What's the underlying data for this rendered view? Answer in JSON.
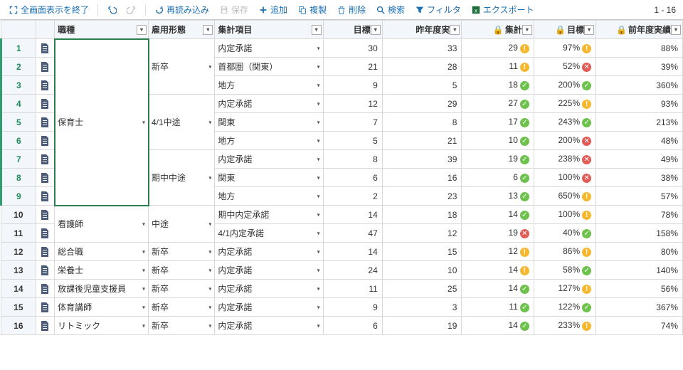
{
  "toolbar": {
    "exit_full": "全画面表示を終了",
    "reload": "再読み込み",
    "save": "保存",
    "add": "追加",
    "copy": "複製",
    "delete": "削除",
    "search": "検索",
    "filter": "フィルタ",
    "export": "エクスポート"
  },
  "status": {
    "range": "1 - 16"
  },
  "columns": {
    "c0": "職種",
    "c1": "雇用形態",
    "c2": "集計項目",
    "c3": "目標値",
    "c4": "昨年度実績",
    "c5": "集計値",
    "c6": "目標比",
    "c7": "前年度実績比"
  },
  "merges": {
    "job_hoiku": "保育士",
    "job_kango": "看護師",
    "job_sogo": "総合職",
    "job_eiyo": "栄養士",
    "job_hokago": "放課後児童支援員",
    "job_taiiku": "体育講師",
    "job_rito": "リトミック",
    "emp_shinsotsu": "新卒",
    "emp_41chuto": "4/1中途",
    "emp_kichu": "期中中途",
    "emp_chuto": "中途"
  },
  "rows": [
    {
      "n": 1,
      "sel": true,
      "c2": "内定承諾",
      "c3": 30,
      "c4": 33,
      "c5": 29,
      "i5": "warn",
      "c6": "97%",
      "i6": "warn",
      "c7": "88%"
    },
    {
      "n": 2,
      "sel": true,
      "c2": "首都圏（関東）",
      "c3": 21,
      "c4": 28,
      "c5": 11,
      "i5": "warn",
      "c6": "52%",
      "i6": "bad",
      "c7": "39%"
    },
    {
      "n": 3,
      "sel": true,
      "c2": "地方",
      "c3": 9,
      "c4": 5,
      "c5": 18,
      "i5": "ok",
      "c6": "200%",
      "i6": "ok",
      "c7": "360%"
    },
    {
      "n": 4,
      "sel": true,
      "c2": "内定承諾",
      "c3": 12,
      "c4": 29,
      "c5": 27,
      "i5": "ok",
      "c6": "225%",
      "i6": "warn",
      "c7": "93%"
    },
    {
      "n": 5,
      "sel": true,
      "c2": "関東",
      "c3": 7,
      "c4": 8,
      "c5": 17,
      "i5": "ok",
      "c6": "243%",
      "i6": "ok",
      "c7": "213%"
    },
    {
      "n": 6,
      "sel": true,
      "c2": "地方",
      "c3": 5,
      "c4": 21,
      "c5": 10,
      "i5": "ok",
      "c6": "200%",
      "i6": "bad",
      "c7": "48%"
    },
    {
      "n": 7,
      "sel": true,
      "c2": "内定承諾",
      "c3": 8,
      "c4": 39,
      "c5": 19,
      "i5": "ok",
      "c6": "238%",
      "i6": "bad",
      "c7": "49%"
    },
    {
      "n": 8,
      "sel": true,
      "c2": "関東",
      "c3": 6,
      "c4": 16,
      "c5": 6,
      "i5": "ok",
      "c6": "100%",
      "i6": "bad",
      "c7": "38%"
    },
    {
      "n": 9,
      "sel": true,
      "c2": "地方",
      "c3": 2,
      "c4": 23,
      "c5": 13,
      "i5": "ok",
      "c6": "650%",
      "i6": "warn",
      "c7": "57%"
    },
    {
      "n": 10,
      "c2": "期中内定承諾",
      "c3": 14,
      "c4": 18,
      "c5": 14,
      "i5": "ok",
      "c6": "100%",
      "i6": "warn",
      "c7": "78%"
    },
    {
      "n": 11,
      "c2": "4/1内定承諾",
      "c3": 47,
      "c4": 12,
      "c5": 19,
      "i5": "bad",
      "c6": "40%",
      "i6": "ok",
      "c7": "158%"
    },
    {
      "n": 12,
      "c2": "内定承諾",
      "c3": 14,
      "c4": 15,
      "c5": 12,
      "i5": "warn",
      "c6": "86%",
      "i6": "warn",
      "c7": "80%"
    },
    {
      "n": 13,
      "c2": "内定承諾",
      "c3": 24,
      "c4": 10,
      "c5": 14,
      "i5": "warn",
      "c6": "58%",
      "i6": "ok",
      "c7": "140%"
    },
    {
      "n": 14,
      "c2": "内定承諾",
      "c3": 11,
      "c4": 25,
      "c5": 14,
      "i5": "ok",
      "c6": "127%",
      "i6": "warn",
      "c7": "56%"
    },
    {
      "n": 15,
      "c2": "内定承諾",
      "c3": 9,
      "c4": 3,
      "c5": 11,
      "i5": "ok",
      "c6": "122%",
      "i6": "ok",
      "c7": "367%"
    },
    {
      "n": 16,
      "c2": "内定承諾",
      "c3": 6,
      "c4": 19,
      "c5": 14,
      "i5": "ok",
      "c6": "233%",
      "i6": "warn",
      "c7": "74%"
    }
  ]
}
